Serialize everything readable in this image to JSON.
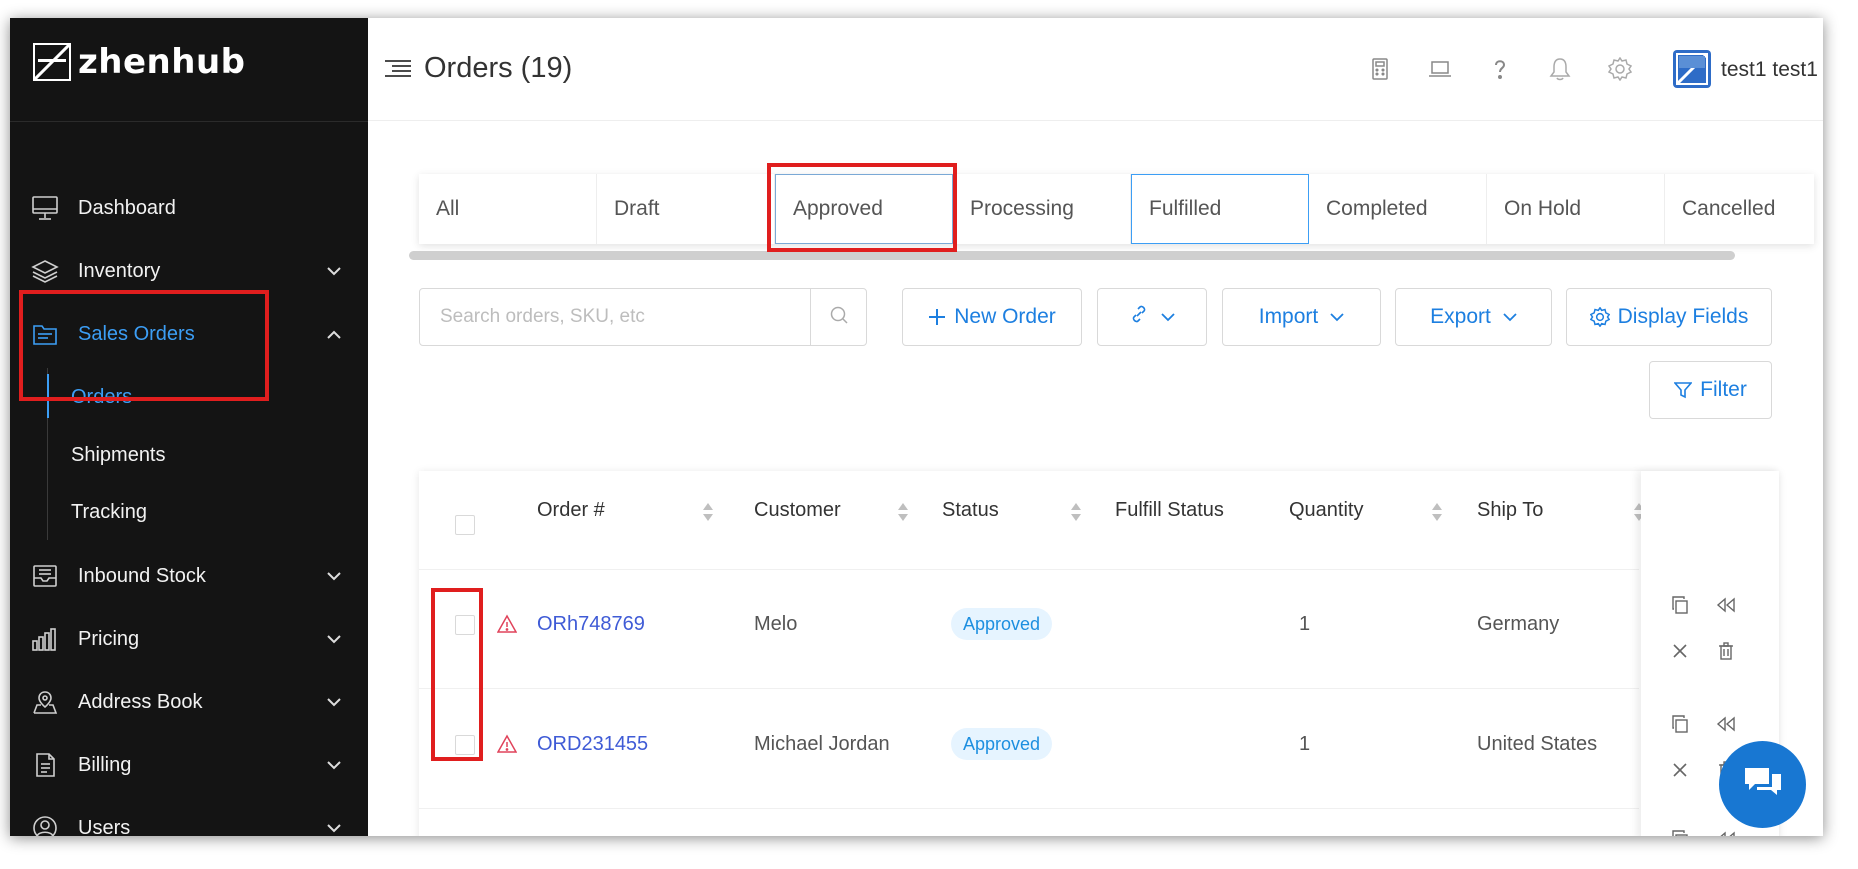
{
  "app": {
    "brand": "zhenhub",
    "page_title": "Orders (19)",
    "user_name": "test1 test1"
  },
  "sidebar": {
    "items": [
      {
        "label": "Dashboard",
        "icon": "monitor-icon",
        "expandable": false
      },
      {
        "label": "Inventory",
        "icon": "layers-icon",
        "expandable": true
      },
      {
        "label": "Sales Orders",
        "icon": "folder-icon",
        "expandable": true,
        "expanded": true
      },
      {
        "label": "Inbound Stock",
        "icon": "tray-icon",
        "expandable": true
      },
      {
        "label": "Pricing",
        "icon": "bar-chart-icon",
        "expandable": true
      },
      {
        "label": "Address Book",
        "icon": "map-pin-icon",
        "expandable": true
      },
      {
        "label": "Billing",
        "icon": "document-icon",
        "expandable": true
      },
      {
        "label": "Users",
        "icon": "users-icon",
        "expandable": true
      }
    ],
    "sub_items": [
      {
        "label": "Orders",
        "active": true
      },
      {
        "label": "Shipments",
        "active": false
      },
      {
        "label": "Tracking",
        "active": false
      }
    ]
  },
  "header": {
    "icons": [
      "calculator-icon",
      "laptop-icon",
      "help-icon",
      "bell-icon",
      "gear-icon"
    ]
  },
  "tabs": [
    "All",
    "Draft",
    "Approved",
    "Processing",
    "Fulfilled",
    "Completed",
    "On Hold",
    "Cancelled"
  ],
  "toolbar": {
    "search_placeholder": "Search orders, SKU, etc",
    "new_order": "New Order",
    "import": "Import",
    "export": "Export",
    "display_fields": "Display Fields",
    "filter": "Filter"
  },
  "table": {
    "columns": [
      "Order #",
      "Customer",
      "Status",
      "Fulfill Status",
      "Quantity",
      "Ship To"
    ],
    "rows": [
      {
        "order": "ORh748769",
        "customer": "Melo",
        "status": "Approved",
        "fulfill_status": "",
        "quantity": "1",
        "ship_to": "Germany"
      },
      {
        "order": "ORD231455",
        "customer": "Michael Jordan",
        "status": "Approved",
        "fulfill_status": "",
        "quantity": "1",
        "ship_to": "United States"
      }
    ]
  },
  "colors": {
    "sidebar_bg": "#141414",
    "accent": "#1d7fe0",
    "link": "#3f5bd6",
    "annotation": "#e01e1e",
    "warning": "#e0425a"
  }
}
